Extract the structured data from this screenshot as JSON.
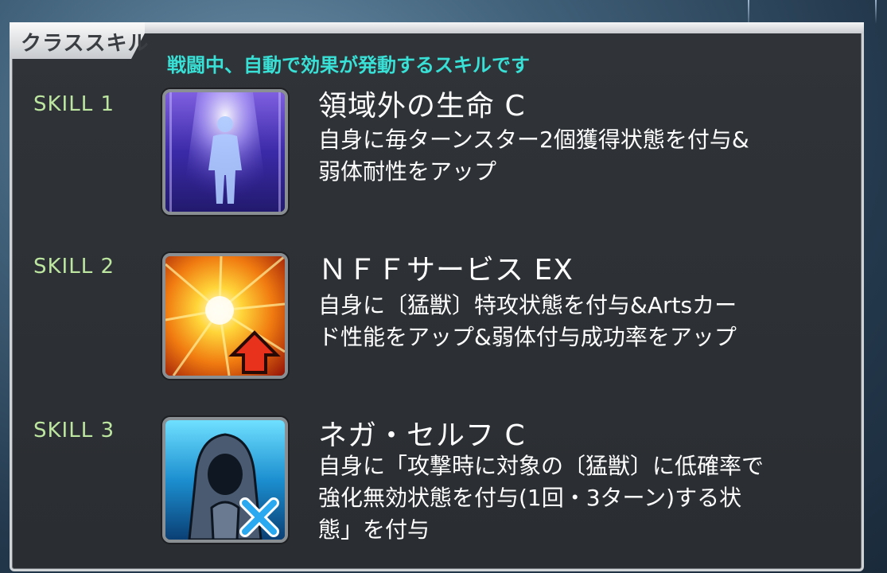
{
  "panel": {
    "title": "クラススキル",
    "subtitle": "戦闘中、自動で効果が発動するスキルです"
  },
  "skills": [
    {
      "label": "SKILL 1",
      "name": "領域外の生命 C",
      "desc_line1": "自身に毎ターンスター2個獲得状態を付与&",
      "desc_line2": "弱体耐性をアップ",
      "icon": "ascending-figure-icon"
    },
    {
      "label": "SKILL 2",
      "name": "ＮＦＦサービス EX",
      "desc_line1": "自身に〔猛獣〕特攻状態を付与&Artsカー",
      "desc_line2": "ド性能をアップ&弱体付与成功率をアップ",
      "icon": "explosion-up-arrow-icon"
    },
    {
      "label": "SKILL 3",
      "name": "ネガ・セルフ C",
      "desc_line1": "自身に「攻撃時に対象の〔猛獣〕に低確率で",
      "desc_line2": "強化無効状態を付与(1回・3ターン)する状",
      "desc_line3": "態」を付与",
      "icon": "hooded-figure-cross-icon"
    }
  ],
  "colors": {
    "subtitle": "#38e0d6",
    "skill_label": "#bde6a0",
    "panel_bg": "#2c2f33"
  }
}
